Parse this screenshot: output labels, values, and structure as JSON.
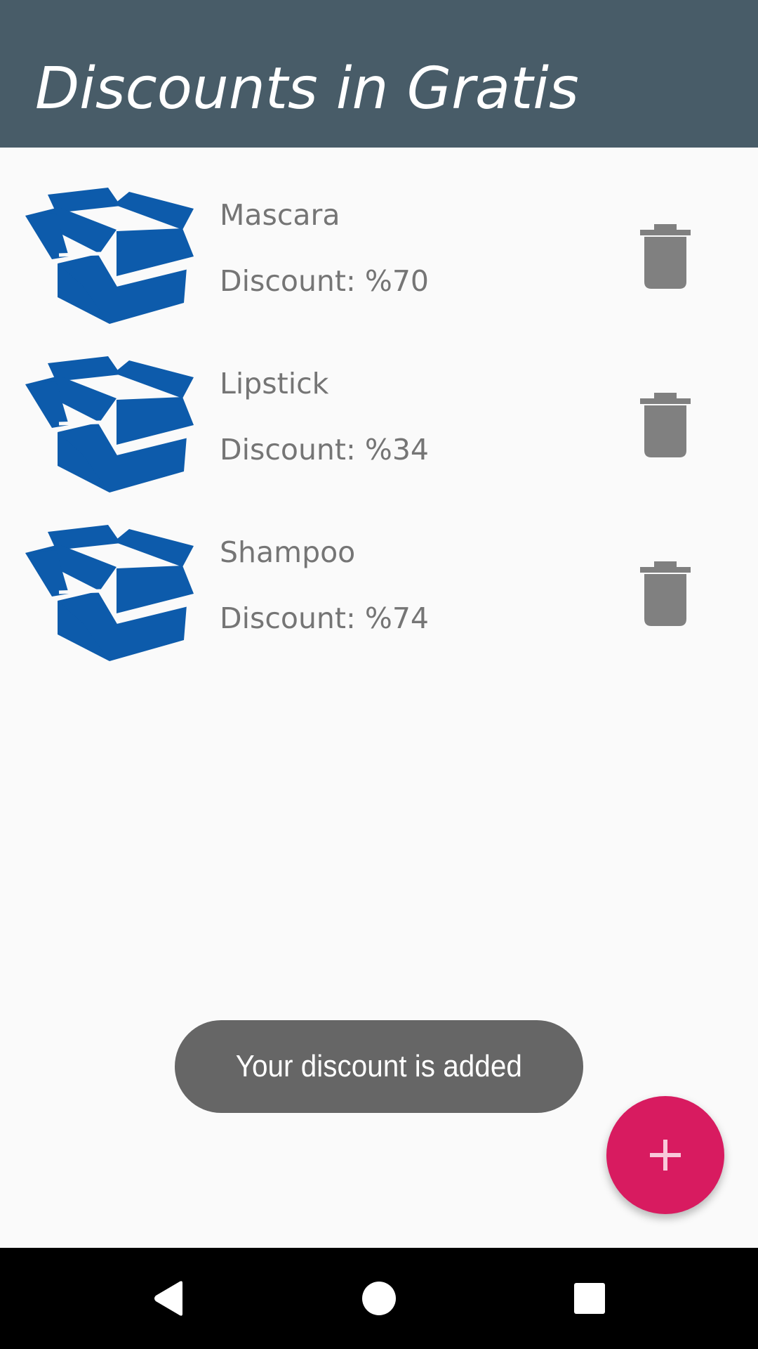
{
  "app_bar": {
    "title": "Discounts in Gratis",
    "color": "#485c68"
  },
  "items": [
    {
      "name": "Mascara",
      "discount_label": "Discount:",
      "discount_value": "%70",
      "icon": "open-box-icon",
      "action_icon": "trash-icon"
    },
    {
      "name": "Lipstick",
      "discount_label": "Discount:",
      "discount_value": "%34",
      "icon": "open-box-icon",
      "action_icon": "trash-icon"
    },
    {
      "name": "Shampoo",
      "discount_label": "Discount:",
      "discount_value": "%74",
      "icon": "open-box-icon",
      "action_icon": "trash-icon"
    }
  ],
  "toast": {
    "message": "Your discount is added"
  },
  "fab": {
    "icon": "plus-icon",
    "color": "#d81b60"
  },
  "nav_bar": {
    "buttons": [
      "back-icon",
      "home-icon",
      "recents-icon"
    ]
  },
  "colors": {
    "box_icon": "#0d5bab",
    "text_secondary": "#757575",
    "trash": "#808080",
    "toast_bg": "#666666"
  }
}
